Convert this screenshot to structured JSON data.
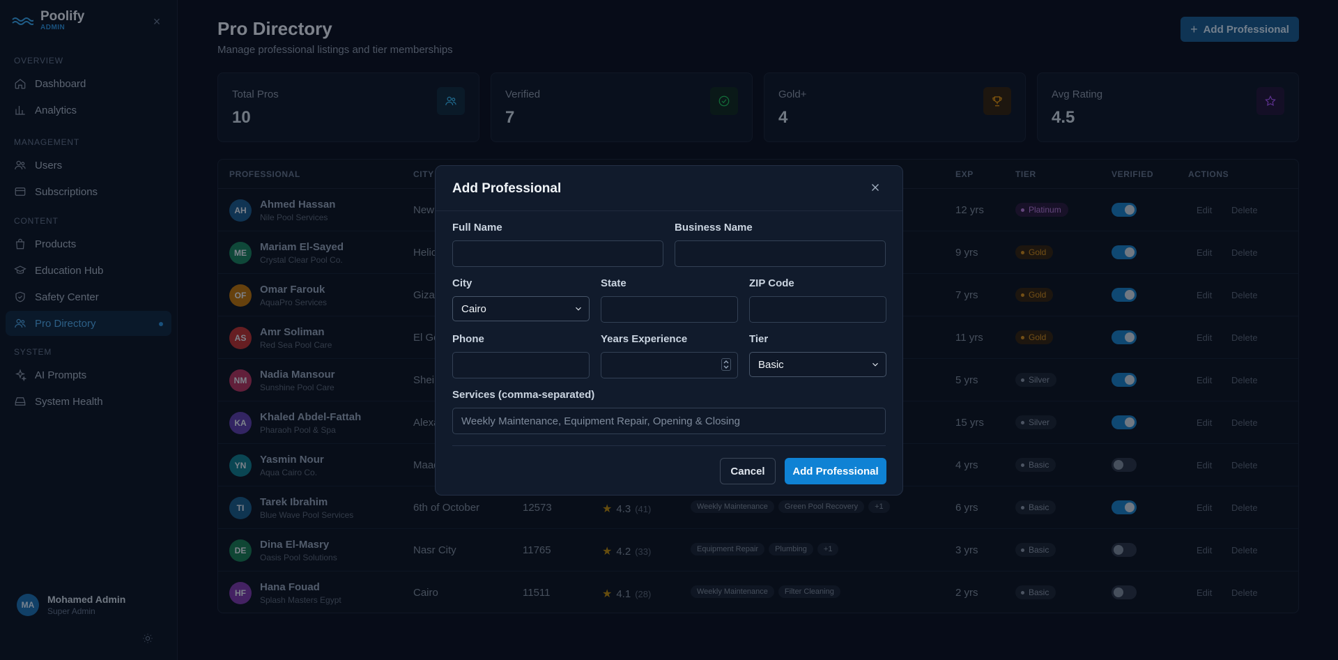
{
  "brand": {
    "name": "Poolify",
    "sub": "ADMIN"
  },
  "nav": {
    "sections": [
      {
        "title": "OVERVIEW",
        "items": [
          {
            "label": "Dashboard",
            "icon": "home-icon"
          },
          {
            "label": "Analytics",
            "icon": "bar-chart-icon"
          }
        ]
      },
      {
        "title": "MANAGEMENT",
        "items": [
          {
            "label": "Users",
            "icon": "users-icon"
          },
          {
            "label": "Subscriptions",
            "icon": "credit-card-icon"
          }
        ]
      },
      {
        "title": "CONTENT",
        "items": [
          {
            "label": "Products",
            "icon": "shopping-bag-icon"
          },
          {
            "label": "Education Hub",
            "icon": "graduation-cap-icon"
          },
          {
            "label": "Safety Center",
            "icon": "shield-check-icon"
          },
          {
            "label": "Pro Directory",
            "icon": "users-gear-icon",
            "active": true
          }
        ]
      },
      {
        "title": "SYSTEM",
        "items": [
          {
            "label": "AI Prompts",
            "icon": "sparkles-icon"
          },
          {
            "label": "System Health",
            "icon": "hard-drive-icon"
          }
        ]
      }
    ]
  },
  "user": {
    "initials": "MA",
    "name": "Mohamed Admin",
    "role": "Super Admin"
  },
  "header": {
    "title": "Pro Directory",
    "subtitle": "Manage professional listings and tier memberships",
    "add_button": "Add Professional"
  },
  "stats": [
    {
      "label": "Total Pros",
      "value": "10",
      "icon": "users-icon",
      "color": "#38bdf8",
      "bg": "#122a3c"
    },
    {
      "label": "Verified",
      "value": "7",
      "icon": "check-circle-icon",
      "color": "#22c55e",
      "bg": "#11291f"
    },
    {
      "label": "Gold+",
      "value": "4",
      "icon": "trophy-icon",
      "color": "#f59e0b",
      "bg": "#33230f"
    },
    {
      "label": "Avg Rating",
      "value": "4.5",
      "icon": "star-icon",
      "color": "#a855f7",
      "bg": "#24173a"
    }
  ],
  "table": {
    "columns": [
      "PROFESSIONAL",
      "CITY",
      "EXP",
      "TIER",
      "VERIFIED",
      "ACTIONS"
    ],
    "rows": [
      {
        "initials": "AH",
        "avatar_color": "#1d5a8a",
        "name": "Ahmed Hassan",
        "business": "Nile Pool Services",
        "city": "New",
        "zip": "",
        "rating": "",
        "count": "",
        "services": [],
        "exp": "12 yrs",
        "tier": "Platinum",
        "verified": true
      },
      {
        "initials": "ME",
        "avatar_color": "#1a7f5c",
        "name": "Mariam El-Sayed",
        "business": "Crystal Clear Pool Co.",
        "city": "Helio",
        "zip": "",
        "rating": "",
        "count": "",
        "services": [],
        "exp": "9 yrs",
        "tier": "Gold",
        "verified": true
      },
      {
        "initials": "OF",
        "avatar_color": "#b8720c",
        "name": "Omar Farouk",
        "business": "AquaPro Services",
        "city": "Giza",
        "zip": "",
        "rating": "",
        "count": "",
        "services": [],
        "exp": "7 yrs",
        "tier": "Gold",
        "verified": true
      },
      {
        "initials": "AS",
        "avatar_color": "#b93232",
        "name": "Amr Soliman",
        "business": "Red Sea Pool Care",
        "city": "El Go",
        "zip": "",
        "rating": "",
        "count": "",
        "services": [],
        "exp": "11 yrs",
        "tier": "Gold",
        "verified": true
      },
      {
        "initials": "NM",
        "avatar_color": "#b0335e",
        "name": "Nadia Mansour",
        "business": "Sunshine Pool Care",
        "city": "Sheik",
        "zip": "",
        "rating": "",
        "count": "",
        "services": [],
        "exp": "5 yrs",
        "tier": "Silver",
        "verified": true
      },
      {
        "initials": "KA",
        "avatar_color": "#5b3ea8",
        "name": "Khaled Abdel-Fattah",
        "business": "Pharaoh Pool & Spa",
        "city": "Alexa",
        "zip": "",
        "rating": "",
        "count": "",
        "services": [],
        "exp": "15 yrs",
        "tier": "Silver",
        "verified": true
      },
      {
        "initials": "YN",
        "avatar_color": "#127a8a",
        "name": "Yasmin Nour",
        "business": "Aqua Cairo Co.",
        "city": "Maad",
        "zip": "",
        "rating": "",
        "count": "",
        "services": [],
        "exp": "4 yrs",
        "tier": "Basic",
        "verified": false
      },
      {
        "initials": "TI",
        "avatar_color": "#1a5b87",
        "name": "Tarek Ibrahim",
        "business": "Blue Wave Pool Services",
        "city": "6th of October",
        "zip": "12573",
        "rating": "4.3",
        "count": "(41)",
        "services": [
          "Weekly Maintenance",
          "Green Pool Recovery",
          "+1"
        ],
        "exp": "6 yrs",
        "tier": "Basic",
        "verified": true
      },
      {
        "initials": "DE",
        "avatar_color": "#1a7a52",
        "name": "Dina El-Masry",
        "business": "Oasis Pool Solutions",
        "city": "Nasr City",
        "zip": "11765",
        "rating": "4.2",
        "count": "(33)",
        "services": [
          "Equipment Repair",
          "Plumbing",
          "+1"
        ],
        "exp": "3 yrs",
        "tier": "Basic",
        "verified": false
      },
      {
        "initials": "HF",
        "avatar_color": "#7a3aa8",
        "name": "Hana Fouad",
        "business": "Splash Masters Egypt",
        "city": "Cairo",
        "zip": "11511",
        "rating": "4.1",
        "count": "(28)",
        "services": [
          "Weekly Maintenance",
          "Filter Cleaning"
        ],
        "exp": "2 yrs",
        "tier": "Basic",
        "verified": false
      }
    ],
    "edit_label": "Edit",
    "delete_label": "Delete"
  },
  "tier_colors": {
    "Platinum": {
      "bg": "#2a1a3d",
      "fg": "#b57ad8"
    },
    "Gold": {
      "bg": "#33240f",
      "fg": "#d08a1c"
    },
    "Silver": {
      "bg": "#1c2534",
      "fg": "#8a96a8"
    },
    "Basic": {
      "bg": "#1c2534",
      "fg": "#8a96a8"
    }
  },
  "modal": {
    "title": "Add Professional",
    "full_name_label": "Full Name",
    "full_name_value": "",
    "business_label": "Business Name",
    "business_value": "",
    "city_label": "City",
    "city_value": "Cairo",
    "state_label": "State",
    "state_value": "",
    "zip_label": "ZIP Code",
    "zip_value": "",
    "phone_label": "Phone",
    "phone_value": "",
    "years_label": "Years Experience",
    "years_value": "",
    "tier_label": "Tier",
    "tier_value": "Basic",
    "services_label": "Services (comma-separated)",
    "services_placeholder": "Weekly Maintenance, Equipment Repair, Opening & Closing",
    "cancel_label": "Cancel",
    "submit_label": "Add Professional"
  }
}
